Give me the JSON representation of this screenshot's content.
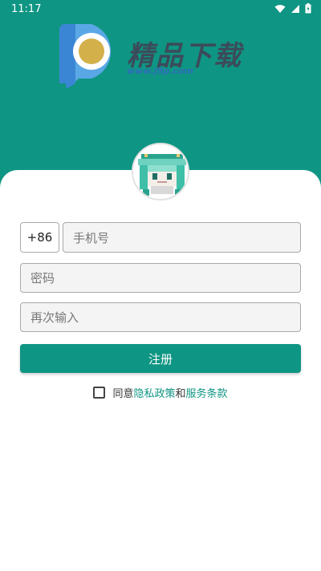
{
  "status_bar": {
    "time": "11:17"
  },
  "brand": {
    "name": "精品下载",
    "url": "www.j9p.com",
    "primary_color": "#0f9583"
  },
  "form": {
    "country_code": "+86",
    "phone_placeholder": "手机号",
    "password_placeholder": "密码",
    "confirm_placeholder": "再次输入",
    "register_label": "注册"
  },
  "agreement": {
    "prefix": "同意",
    "privacy_link": "隐私政策",
    "conjunction": "和",
    "terms_link": "服务条款",
    "checked": false
  }
}
